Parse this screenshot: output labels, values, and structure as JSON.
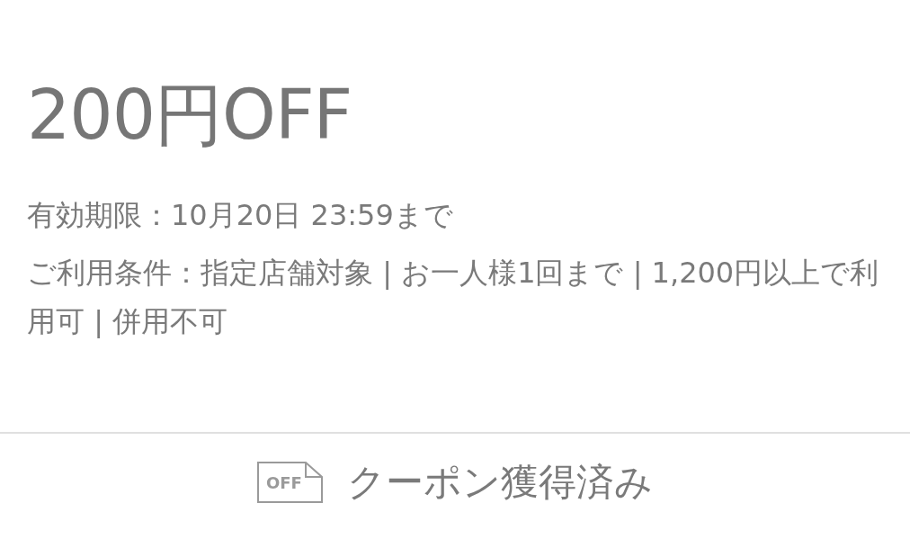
{
  "coupon": {
    "title": "200円OFF",
    "expiry": "有効期限：10月20日 23:59まで",
    "conditions": "ご利用条件：指定店舗対象 | お一人様1回まで | 1,200円以上で利用可 | 併用不可"
  },
  "status_button": {
    "icon_text": "OFF",
    "label": "クーポン獲得済み",
    "acquired": true
  }
}
